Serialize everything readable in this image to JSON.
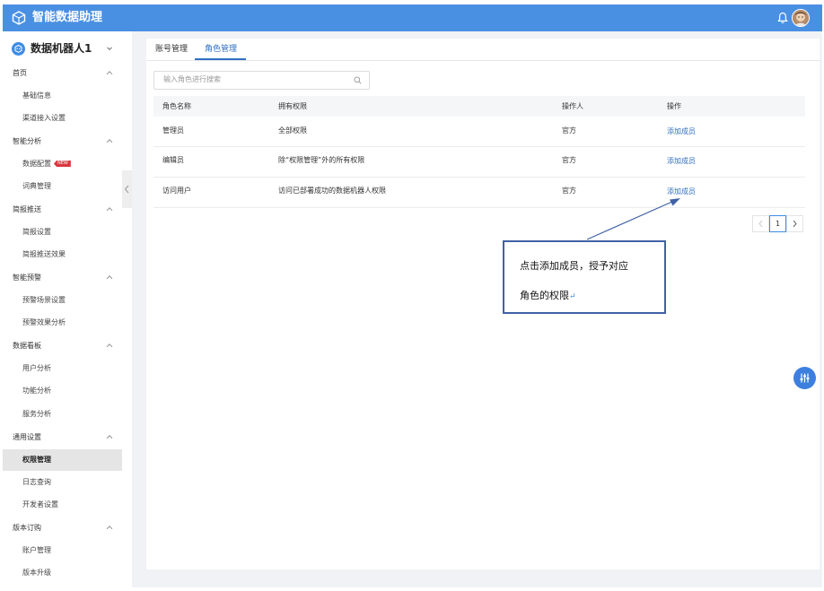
{
  "app": {
    "title": "智能数据助理"
  },
  "sidebar": {
    "bot_name": "数据机器人1",
    "groups": [
      {
        "label": "首页",
        "items": [
          "基础信息",
          "渠道接入设置"
        ]
      },
      {
        "label": "智能分析",
        "items": [
          "数据配置",
          "词典管理"
        ]
      },
      {
        "label": "简报推送",
        "items": [
          "简报设置",
          "简报推送效果"
        ]
      },
      {
        "label": "智能预警",
        "items": [
          "预警场景设置",
          "预警效果分析"
        ]
      },
      {
        "label": "数据看板",
        "items": [
          "用户分析",
          "功能分析",
          "服务分析"
        ]
      },
      {
        "label": "通用设置",
        "items": [
          "权限管理",
          "日志查询",
          "开发者设置"
        ]
      },
      {
        "label": "版本订购",
        "items": [
          "账户管理",
          "版本升级"
        ]
      }
    ],
    "new_badge": "NEW",
    "active_item": "权限管理"
  },
  "tabs": [
    {
      "label": "账号管理",
      "active": false
    },
    {
      "label": "角色管理",
      "active": true
    }
  ],
  "search": {
    "placeholder": "输入角色进行搜索"
  },
  "table": {
    "headers": [
      "角色名称",
      "拥有权限",
      "操作人",
      "操作"
    ],
    "rows": [
      {
        "role": "管理员",
        "permission": "全部权限",
        "operator": "官方",
        "action": "添加成员"
      },
      {
        "role": "编辑员",
        "permission": "除“权限管理”外的所有权限",
        "operator": "官方",
        "action": "添加成员"
      },
      {
        "role": "访问用户",
        "permission": "访问已部署成功的数据机器人权限",
        "operator": "官方",
        "action": "添加成员"
      }
    ]
  },
  "pagination": {
    "current_page": "1"
  },
  "callout": {
    "line1": "点击添加成员，授予对应",
    "line2": "角色的权限",
    "return_mark": "↵"
  },
  "colors": {
    "header_bar": "#4a90e2",
    "accent": "#2f6fc4",
    "new_badge": "#d9363e",
    "fab": "#3d7fde"
  }
}
